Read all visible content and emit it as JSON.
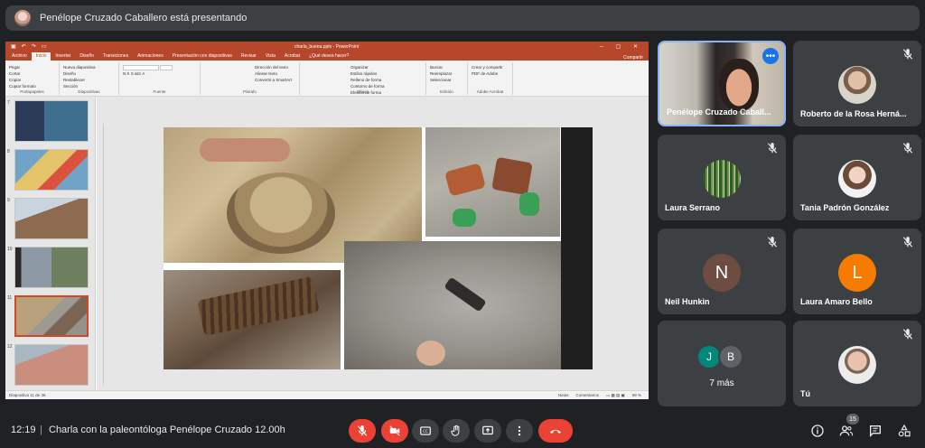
{
  "banner": {
    "text": "Penélope Cruzado Caballero está presentando"
  },
  "powerpoint": {
    "file_name": "charla_buena.pptx - PowerPoint",
    "tabs": [
      "Archivo",
      "Inicio",
      "Insertar",
      "Diseño",
      "Transiciones",
      "Animaciones",
      "Presentación con diapositivas",
      "Revisar",
      "Vista",
      "Acrobat",
      "¿Qué desea hacer?"
    ],
    "share": "Compartir",
    "ribbon_groups": [
      {
        "label": "Portapapeles",
        "items": [
          "Pegar",
          "Cortar",
          "Copiar",
          "Copiar formato"
        ]
      },
      {
        "label": "Diapositivas",
        "items": [
          "Nueva diapositiva",
          "Diseño",
          "Restablecer",
          "Sección"
        ]
      },
      {
        "label": "Fuente",
        "items": []
      },
      {
        "label": "Párrafo",
        "items": [
          "Dirección del texto",
          "Alinear texto",
          "Convertir a SmartArt"
        ]
      },
      {
        "label": "Dibujo",
        "items": [
          "Organizar",
          "Estilos rápidos",
          "Relleno de forma",
          "Contorno de forma",
          "Efectos de forma"
        ]
      },
      {
        "label": "Edición",
        "items": [
          "Buscar",
          "Reemplazar",
          "Seleccionar"
        ]
      },
      {
        "label": "Adobe Acrobat",
        "items": [
          "Crear y compartir PDF de Adobe"
        ]
      }
    ],
    "thumbnails": [
      "7",
      "8",
      "9",
      "10",
      "11",
      "12"
    ],
    "selected_thumbnail": "11",
    "status_left": "Diapositiva 11 de 36",
    "status_notes": "Notas",
    "status_comments": "Comentarios",
    "zoom": "69 %"
  },
  "participants": [
    {
      "name": "Penélope Cruzado Caball...",
      "type": "video"
    },
    {
      "name": "Roberto de la Rosa Herná...",
      "type": "photo",
      "muted": true
    },
    {
      "name": "Laura Serrano",
      "type": "photo",
      "muted": true
    },
    {
      "name": "Tania Padrón González",
      "type": "photo",
      "muted": true
    },
    {
      "name": "Neil Hunkin",
      "type": "initial",
      "initial": "N",
      "color": "#6d4c41",
      "muted": true
    },
    {
      "name": "Laura Amaro Bello",
      "type": "initial",
      "initial": "L",
      "color": "#f57c00",
      "muted": true
    },
    {
      "name": "7 más",
      "type": "more",
      "initials": [
        "J",
        "B"
      ],
      "colors": [
        "#00897b",
        "#5f6368"
      ]
    },
    {
      "name": "Tú",
      "type": "photo",
      "muted": true
    }
  ],
  "bottom": {
    "time": "12:19",
    "separator": "|",
    "meeting_title": "Charla con la paleontóloga Penélope Cruzado 12.00h",
    "participants_count": "15"
  },
  "colors": {
    "accent": "#8ab4f8",
    "danger": "#ea4335",
    "ppt": "#b7472a"
  }
}
